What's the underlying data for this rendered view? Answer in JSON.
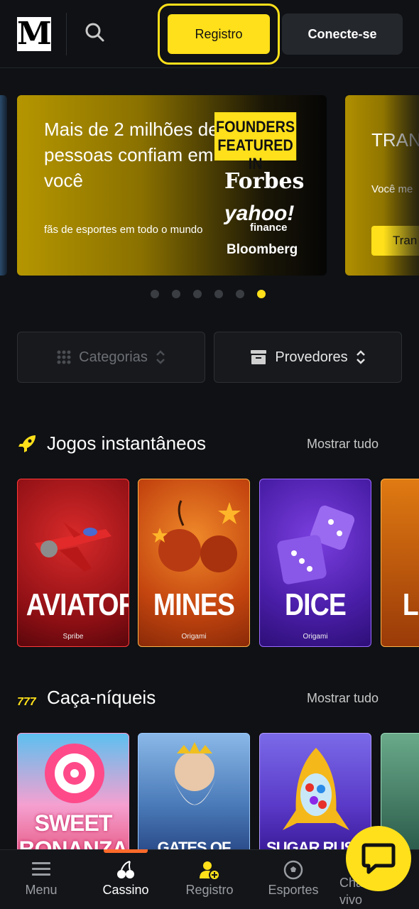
{
  "header": {
    "logo_letter": "M",
    "register_label": "Registro",
    "login_label": "Conecte-se"
  },
  "banner": {
    "title": "Mais de 2 milhões de pessoas confiam em você",
    "subtitle": "fãs de esportes em todo o mundo",
    "badge": "FOUNDERS FEATURED IN",
    "press": [
      "Forbes",
      "yahoo!",
      "finance",
      "Bloomberg"
    ],
    "next_title": "TRAN DE S",
    "next_subtitle": "Você me",
    "next_button": "Tran",
    "dots_total": 6,
    "active_dot": 6
  },
  "filters": {
    "categories_label": "Categorias",
    "providers_label": "Provedores"
  },
  "instant_games": {
    "title": "Jogos instantâneos",
    "show_all": "Mostrar tudo",
    "games": [
      {
        "name": "AVIATOR",
        "provider": "Spribe"
      },
      {
        "name": "MINES",
        "provider": "Origami"
      },
      {
        "name": "DICE",
        "provider": "Origami"
      },
      {
        "name": "L",
        "provider": ""
      }
    ]
  },
  "slots": {
    "title": "Caça-níqueis",
    "show_all": "Mostrar tudo",
    "games": [
      {
        "name": "SWEET BONANZA"
      },
      {
        "name": "GATES OF"
      },
      {
        "name": "SUGAR RUSH"
      }
    ]
  },
  "bottom_nav": {
    "items": [
      {
        "label": "Menu"
      },
      {
        "label": "Cassino"
      },
      {
        "label": "Registro"
      },
      {
        "label": "Esportes"
      },
      {
        "label": "Chat ao vivo"
      }
    ]
  },
  "colors": {
    "accent": "#ffe01a",
    "background": "#0f1114",
    "nav_indicator": "#ff6a2a"
  }
}
